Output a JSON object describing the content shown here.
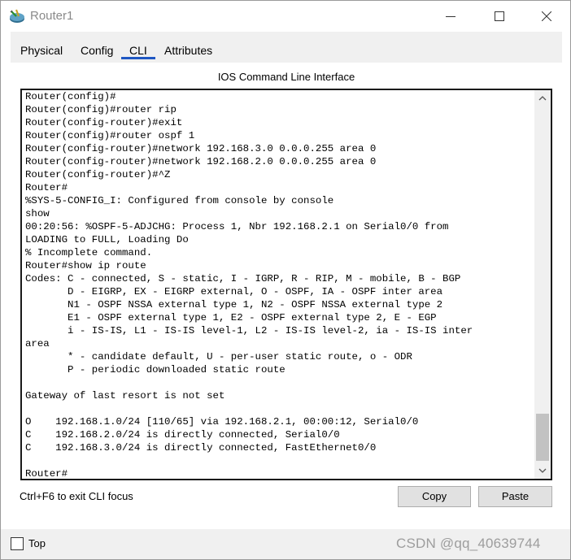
{
  "window": {
    "title": "Router1",
    "icon": "router-icon"
  },
  "tabs": [
    {
      "label": "Physical",
      "active": false
    },
    {
      "label": "Config",
      "active": false
    },
    {
      "label": "CLI",
      "active": true
    },
    {
      "label": "Attributes",
      "active": false
    }
  ],
  "cli": {
    "header": "IOS Command Line Interface",
    "lines": [
      "Router(config)#",
      "Router(config)#router rip",
      "Router(config-router)#exit",
      "Router(config)#router ospf 1",
      "Router(config-router)#network 192.168.3.0 0.0.0.255 area 0",
      "Router(config-router)#network 192.168.2.0 0.0.0.255 area 0",
      "Router(config-router)#^Z",
      "Router#",
      "%SYS-5-CONFIG_I: Configured from console by console",
      "show",
      "00:20:56: %OSPF-5-ADJCHG: Process 1, Nbr 192.168.2.1 on Serial0/0 from",
      "LOADING to FULL, Loading Do",
      "% Incomplete command.",
      "Router#show ip route",
      "Codes: C - connected, S - static, I - IGRP, R - RIP, M - mobile, B - BGP",
      "       D - EIGRP, EX - EIGRP external, O - OSPF, IA - OSPF inter area",
      "       N1 - OSPF NSSA external type 1, N2 - OSPF NSSA external type 2",
      "       E1 - OSPF external type 1, E2 - OSPF external type 2, E - EGP",
      "       i - IS-IS, L1 - IS-IS level-1, L2 - IS-IS level-2, ia - IS-IS inter",
      "area",
      "       * - candidate default, U - per-user static route, o - ODR",
      "       P - periodic downloaded static route",
      "",
      "Gateway of last resort is not set",
      "",
      "O    192.168.1.0/24 [110/65] via 192.168.2.1, 00:00:12, Serial0/0",
      "C    192.168.2.0/24 is directly connected, Serial0/0",
      "C    192.168.3.0/24 is directly connected, FastEthernet0/0",
      "",
      "Router#"
    ],
    "exit_hint": "Ctrl+F6 to exit CLI focus",
    "copy_label": "Copy",
    "paste_label": "Paste"
  },
  "footer": {
    "top_label": "Top",
    "top_checked": false,
    "watermark": "CSDN @qq_40639744"
  }
}
